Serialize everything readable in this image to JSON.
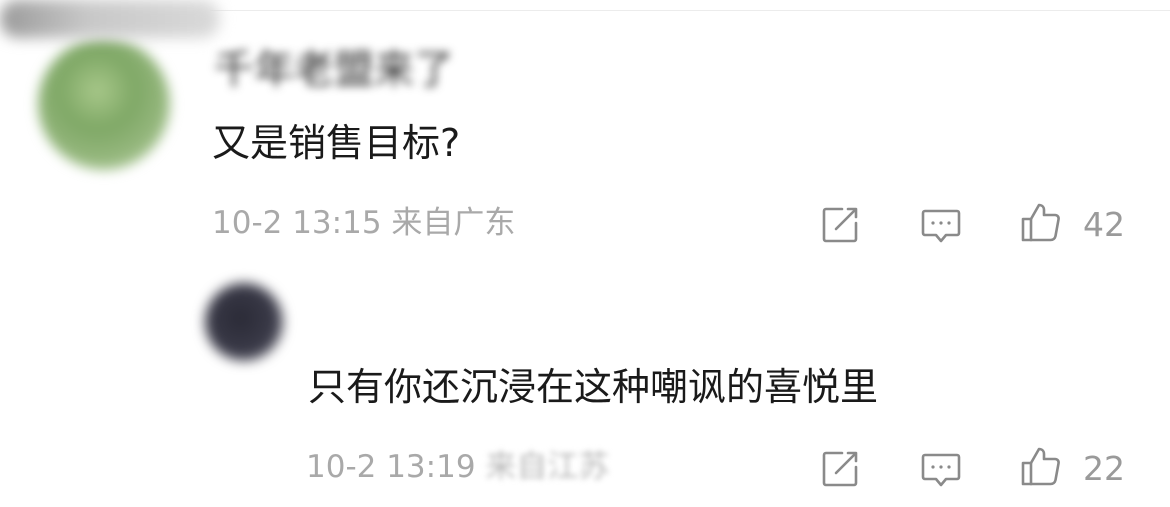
{
  "comments": [
    {
      "author": "千年老盟来了",
      "text": "又是销售目标?",
      "timestamp": "10-2 13:15",
      "location": "来自广东",
      "likes": "42",
      "avatar_icon": "avatar",
      "actions": [
        "edit-icon",
        "comment-icon",
        "thumbs-up-icon"
      ]
    },
    {
      "author": "",
      "text": "只有你还沉浸在这种嘲讽的喜悦里",
      "timestamp": "10-2 13:19",
      "location": "来自江苏",
      "likes": "22",
      "avatar_icon": "avatar",
      "actions": [
        "edit-icon",
        "comment-icon",
        "thumbs-up-icon"
      ]
    }
  ],
  "colors": {
    "text": "#1a1a1a",
    "meta": "#a9a9a9",
    "icon": "#8a8a8a"
  }
}
